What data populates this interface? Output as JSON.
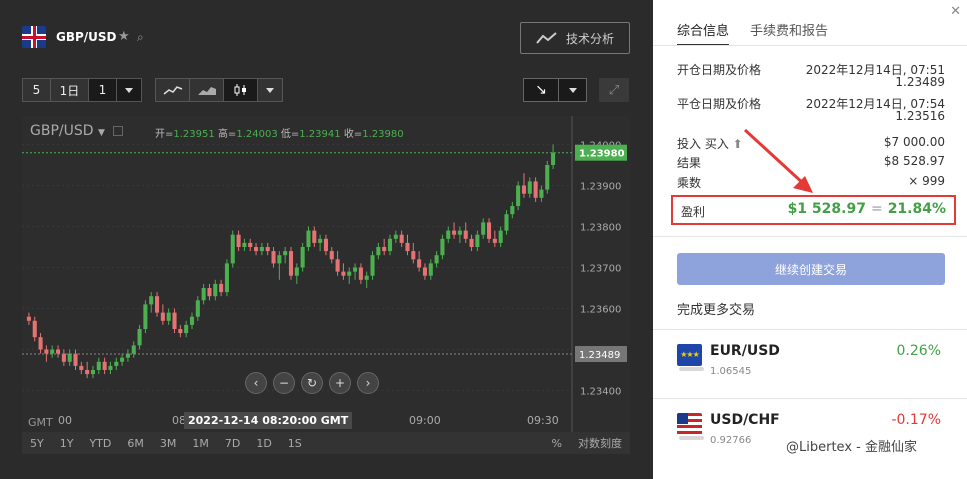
{
  "header": {
    "pair": "GBP/USD",
    "ta_button": "技术分析"
  },
  "toolbar": {
    "interval_count": "5",
    "period": "1日",
    "multiplier": "1"
  },
  "chart": {
    "symbol_label": "GBP/USD",
    "ohlc_label_open": "开=",
    "ohlc_open": "1.23951",
    "ohlc_label_high": "高=",
    "ohlc_high": "1.24003",
    "ohlc_label_low": "低=",
    "ohlc_low": "1.23941",
    "ohlc_label_close": "收=",
    "ohlc_close": "1.23980",
    "price_tag_current": "1.23980",
    "price_tag_entry": "1.23489",
    "y_ticks": [
      "1.24000",
      "1.23900",
      "1.23800",
      "1.23700",
      "1.23600",
      "1.23500",
      "1.23400"
    ],
    "x_ticks": [
      "08:00",
      "09:00",
      "09:30"
    ],
    "x_tick_edge": "00",
    "gmt": "GMT",
    "crosshair_time": "2022-12-14 08:20:00 GMT",
    "ranges": [
      "5Y",
      "1Y",
      "YTD",
      "6M",
      "3M",
      "1M",
      "7D",
      "1D",
      "1S"
    ],
    "pct": "%",
    "log": "对数刻度"
  },
  "right": {
    "tabs": [
      "综合信息",
      "手续费和报告"
    ],
    "open_label": "开仓日期及价格",
    "open_date": "2022年12月14日, 07:51",
    "open_price": "1.23489",
    "close_label": "平仓日期及价格",
    "close_date": "2022年12月14日, 07:54",
    "close_price": "1.23516",
    "invest_label": "投入 买入",
    "invest_value": "$7 000.00",
    "result_label": "结果",
    "result_value": "$8 528.97",
    "mult_label": "乘数",
    "mult_value": "× 999",
    "profit_label": "盈利",
    "profit_value": "$1 528.97",
    "profit_eq": "=",
    "profit_pct": "21.84%",
    "cta": "继续创建交易",
    "more": "完成更多交易",
    "pairs": [
      {
        "name": "EUR/USD",
        "price": "1.06545",
        "change": "0.26%",
        "color": "#43a047"
      },
      {
        "name": "USD/CHF",
        "price": "0.92766",
        "change": "-0.17%",
        "color": "#e53935"
      }
    ],
    "watermark": "@Libertex - 金融仙家"
  },
  "colors": {
    "up": "#4caf50",
    "down": "#e57373",
    "accent": "#8ea3dc",
    "highlight": "#e53935"
  },
  "chart_data": {
    "type": "candlestick",
    "symbol": "GBP/USD",
    "ylim": [
      1.2335,
      1.2405
    ],
    "candles": [
      [
        1.2358,
        1.2359,
        1.2356,
        1.2357
      ],
      [
        1.2357,
        1.2358,
        1.2352,
        1.2353
      ],
      [
        1.2353,
        1.2354,
        1.2349,
        1.235
      ],
      [
        1.235,
        1.2351,
        1.2347,
        1.2349
      ],
      [
        1.2349,
        1.2351,
        1.2348,
        1.235
      ],
      [
        1.235,
        1.2351,
        1.2348,
        1.2349
      ],
      [
        1.2349,
        1.235,
        1.2346,
        1.2347
      ],
      [
        1.2347,
        1.235,
        1.2346,
        1.2349
      ],
      [
        1.2349,
        1.235,
        1.2345,
        1.2346
      ],
      [
        1.2346,
        1.2347,
        1.2344,
        1.2345
      ],
      [
        1.2345,
        1.2347,
        1.2343,
        1.2344
      ],
      [
        1.2344,
        1.2346,
        1.2343,
        1.2345
      ],
      [
        1.2345,
        1.2348,
        1.2344,
        1.2347
      ],
      [
        1.2347,
        1.2348,
        1.2344,
        1.2345
      ],
      [
        1.2345,
        1.2347,
        1.2344,
        1.2346
      ],
      [
        1.2346,
        1.2348,
        1.2345,
        1.2347
      ],
      [
        1.2347,
        1.2349,
        1.2346,
        1.2348
      ],
      [
        1.2348,
        1.235,
        1.2347,
        1.2349
      ],
      [
        1.2349,
        1.2352,
        1.2348,
        1.2351
      ],
      [
        1.2351,
        1.2356,
        1.235,
        1.2355
      ],
      [
        1.2355,
        1.2362,
        1.2354,
        1.2361
      ],
      [
        1.2361,
        1.2364,
        1.2359,
        1.2363
      ],
      [
        1.2363,
        1.2364,
        1.2358,
        1.2359
      ],
      [
        1.2359,
        1.2361,
        1.2356,
        1.2357
      ],
      [
        1.2357,
        1.236,
        1.2356,
        1.2359
      ],
      [
        1.2359,
        1.236,
        1.2354,
        1.2355
      ],
      [
        1.2355,
        1.2356,
        1.2353,
        1.2354
      ],
      [
        1.2354,
        1.2357,
        1.2353,
        1.2356
      ],
      [
        1.2356,
        1.2359,
        1.2355,
        1.2358
      ],
      [
        1.2358,
        1.2363,
        1.2357,
        1.2362
      ],
      [
        1.2362,
        1.2366,
        1.2361,
        1.2365
      ],
      [
        1.2365,
        1.2366,
        1.2362,
        1.2363
      ],
      [
        1.2363,
        1.2367,
        1.2362,
        1.2366
      ],
      [
        1.2366,
        1.2367,
        1.2363,
        1.2364
      ],
      [
        1.2364,
        1.2372,
        1.2363,
        1.2371
      ],
      [
        1.2371,
        1.2379,
        1.237,
        1.2378
      ],
      [
        1.2378,
        1.2379,
        1.2374,
        1.2375
      ],
      [
        1.2375,
        1.2377,
        1.2374,
        1.2376
      ],
      [
        1.2376,
        1.2377,
        1.2374,
        1.2375
      ],
      [
        1.2375,
        1.2376,
        1.2373,
        1.2374
      ],
      [
        1.2374,
        1.2376,
        1.2373,
        1.2375
      ],
      [
        1.2375,
        1.2376,
        1.2373,
        1.2374
      ],
      [
        1.2374,
        1.2375,
        1.237,
        1.2371
      ],
      [
        1.2371,
        1.2374,
        1.2367,
        1.2373
      ],
      [
        1.2373,
        1.2375,
        1.2371,
        1.2374
      ],
      [
        1.2374,
        1.2375,
        1.2367,
        1.2368
      ],
      [
        1.2368,
        1.2371,
        1.2366,
        1.237
      ],
      [
        1.237,
        1.2376,
        1.2369,
        1.2375
      ],
      [
        1.2375,
        1.238,
        1.2374,
        1.2379
      ],
      [
        1.2379,
        1.238,
        1.2375,
        1.2376
      ],
      [
        1.2376,
        1.2378,
        1.2374,
        1.2377
      ],
      [
        1.2377,
        1.2378,
        1.2373,
        1.2374
      ],
      [
        1.2374,
        1.2375,
        1.2371,
        1.2372
      ],
      [
        1.2372,
        1.2374,
        1.2368,
        1.2369
      ],
      [
        1.2369,
        1.2371,
        1.2367,
        1.2368
      ],
      [
        1.2368,
        1.237,
        1.2366,
        1.2369
      ],
      [
        1.2369,
        1.2371,
        1.2367,
        1.237
      ],
      [
        1.237,
        1.2371,
        1.2366,
        1.2367
      ],
      [
        1.2367,
        1.2369,
        1.2365,
        1.2368
      ],
      [
        1.2368,
        1.2374,
        1.2367,
        1.2373
      ],
      [
        1.2373,
        1.2376,
        1.2372,
        1.2375
      ],
      [
        1.2375,
        1.2377,
        1.2373,
        1.2374
      ],
      [
        1.2374,
        1.2378,
        1.2373,
        1.2377
      ],
      [
        1.2377,
        1.2379,
        1.2376,
        1.2378
      ],
      [
        1.2378,
        1.2379,
        1.2375,
        1.2376
      ],
      [
        1.2376,
        1.2378,
        1.2373,
        1.2374
      ],
      [
        1.2374,
        1.2376,
        1.2371,
        1.2372
      ],
      [
        1.2372,
        1.2374,
        1.2369,
        1.237
      ],
      [
        1.237,
        1.2371,
        1.2367,
        1.2368
      ],
      [
        1.2368,
        1.2372,
        1.2367,
        1.2371
      ],
      [
        1.2371,
        1.2374,
        1.237,
        1.2373
      ],
      [
        1.2373,
        1.2378,
        1.2372,
        1.2377
      ],
      [
        1.2377,
        1.238,
        1.2376,
        1.2379
      ],
      [
        1.2379,
        1.2381,
        1.2377,
        1.2378
      ],
      [
        1.2378,
        1.238,
        1.2376,
        1.2379
      ],
      [
        1.2379,
        1.2381,
        1.2376,
        1.2377
      ],
      [
        1.2377,
        1.2378,
        1.2374,
        1.2375
      ],
      [
        1.2375,
        1.2379,
        1.2374,
        1.2378
      ],
      [
        1.2378,
        1.2382,
        1.2377,
        1.2381
      ],
      [
        1.2381,
        1.2382,
        1.2376,
        1.2377
      ],
      [
        1.2377,
        1.2379,
        1.2375,
        1.2376
      ],
      [
        1.2376,
        1.238,
        1.2375,
        1.2379
      ],
      [
        1.2379,
        1.2384,
        1.2378,
        1.2383
      ],
      [
        1.2383,
        1.2386,
        1.2382,
        1.2385
      ],
      [
        1.2385,
        1.2391,
        1.2384,
        1.239
      ],
      [
        1.239,
        1.2393,
        1.2387,
        1.2388
      ],
      [
        1.2388,
        1.2392,
        1.2387,
        1.2391
      ],
      [
        1.2391,
        1.2392,
        1.2386,
        1.2387
      ],
      [
        1.2387,
        1.239,
        1.2386,
        1.2389
      ],
      [
        1.2389,
        1.2396,
        1.2388,
        1.2395
      ],
      [
        1.2395,
        1.24,
        1.2394,
        1.2398
      ]
    ]
  }
}
